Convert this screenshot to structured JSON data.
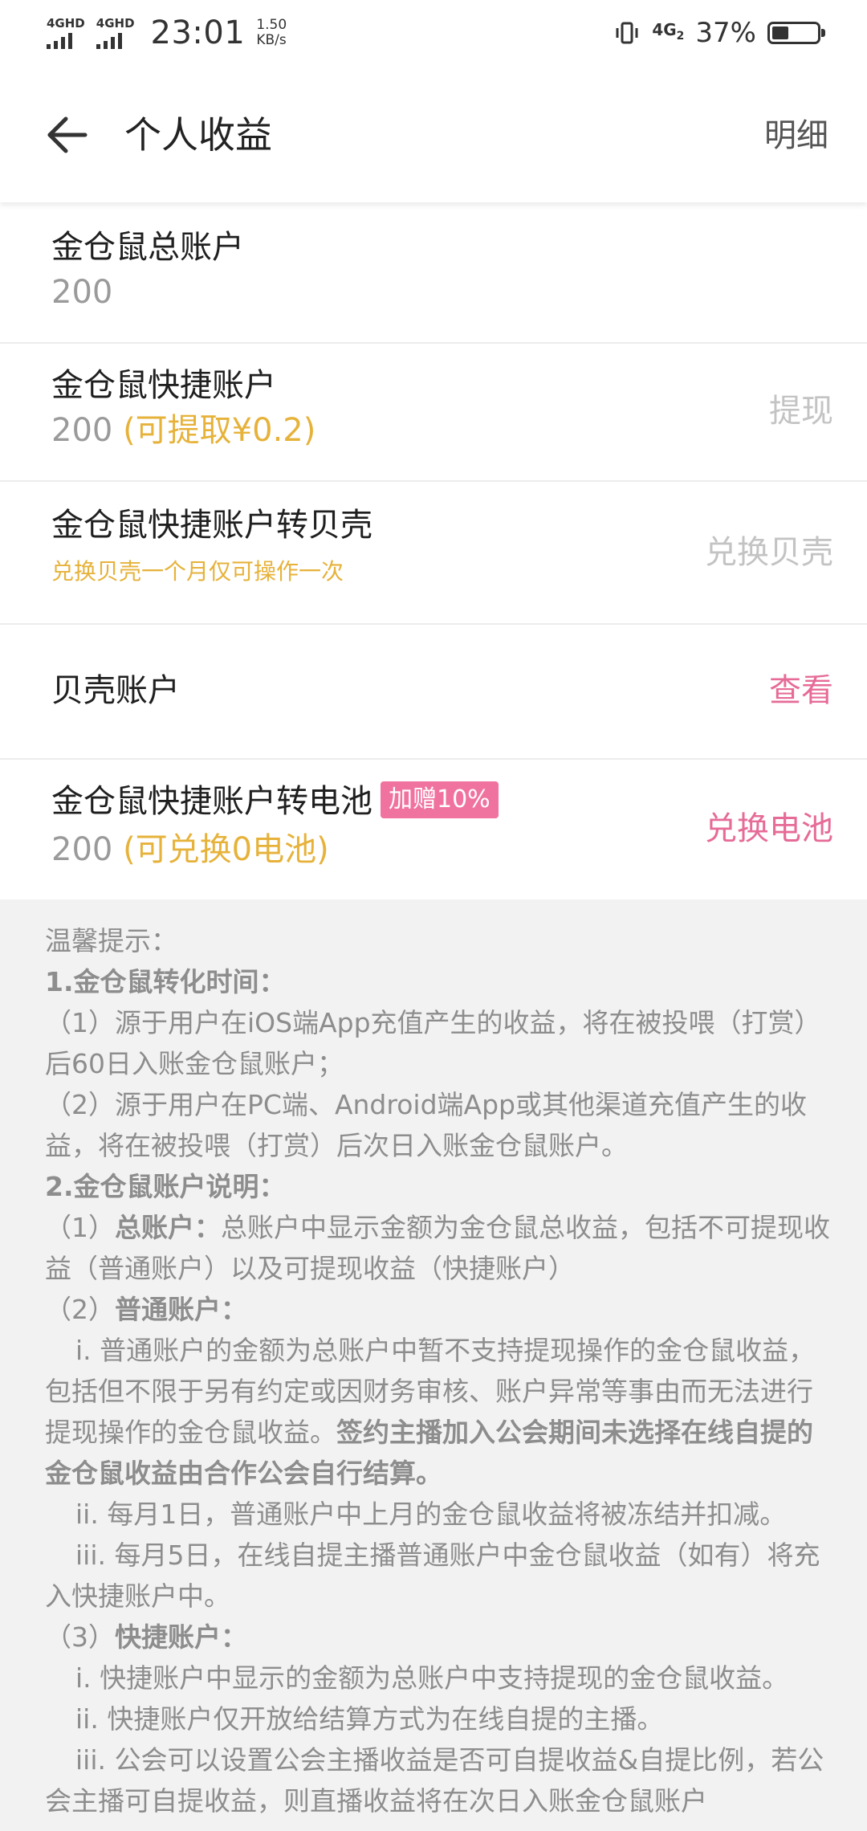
{
  "status_bar": {
    "sim1_label": "4GHD",
    "sim2_label": "4GHD",
    "time": "23:01",
    "speed_value": "1.50",
    "speed_unit": "KB/s",
    "net_label": "4G",
    "net_sub": "2",
    "battery_percent": "37%",
    "battery_level": 0.37
  },
  "header": {
    "title": "个人收益",
    "detail_label": "明细"
  },
  "accounts": {
    "total": {
      "title": "金仓鼠总账户",
      "value": "200"
    },
    "quick": {
      "title": "金仓鼠快捷账户",
      "value": "200",
      "hint": "(可提取¥0.2)",
      "action": "提现"
    },
    "shell_exchange": {
      "title": "金仓鼠快捷账户转贝壳",
      "sub": "兑换贝壳一个月仅可操作一次",
      "action": "兑换贝壳"
    },
    "shell_account": {
      "title": "贝壳账户",
      "action": "查看"
    },
    "battery_exchange": {
      "title": "金仓鼠快捷账户转电池",
      "badge": "加赠10%",
      "value": "200",
      "hint": "(可兑换0电池)",
      "action": "兑换电池"
    }
  },
  "tips": {
    "heading": "温馨提示：",
    "s1_title": "1.金仓鼠转化时间：",
    "s1_p1": "（1）源于用户在iOS端App充值产生的收益，将在被投喂（打赏）后60日入账金仓鼠账户；",
    "s1_p2": "（2）源于用户在PC端、Android端App或其他渠道充值产生的收益，将在被投喂（打赏）后次日入账金仓鼠账户。",
    "s2_title": "2.金仓鼠账户说明：",
    "s2_p1_prefix": "（1）",
    "s2_p1_bold": "总账户：",
    "s2_p1_text": "总账户中显示金额为金仓鼠总收益，包括不可提现收益（普通账户）以及可提现收益（快捷账户）",
    "s2_p2_prefix": "（2）",
    "s2_p2_bold": "普通账户：",
    "s2_p2_i_text": "i. 普通账户的金额为总账户中暂不支持提现操作的金仓鼠收益，包括但不限于另有约定或因财务审核、账户异常等事由而无法进行提现操作的金仓鼠收益。",
    "s2_p2_i_bold": "签约主播加入公会期间未选择在线自提的金仓鼠收益由合作公会自行结算。",
    "s2_p2_ii": "ii. 每月1日，普通账户中上月的金仓鼠收益将被冻结并扣减。",
    "s2_p2_iii": "iii. 每月5日，在线自提主播普通账户中金仓鼠收益（如有）将充入快捷账户中。",
    "s2_p3_prefix": "（3）",
    "s2_p3_bold": "快捷账户：",
    "s2_p3_i": "i. 快捷账户中显示的金额为总账户中支持提现的金仓鼠收益。",
    "s2_p3_ii": "ii. 快捷账户仅开放给结算方式为在线自提的主播。",
    "s2_p3_iii": "iii. 公会可以设置公会主播收益是否可自提收益&自提比例，若公会主播可自提收益，则直播收益将在次日入账金仓鼠账户"
  },
  "colors": {
    "accent_pink": "#e66b97",
    "badge_pink": "#f0739f",
    "hint_yellow": "#e6b23a",
    "muted_gray": "#9a9a9a",
    "tips_bg": "#f2f2f2"
  },
  "icons": {
    "back": "arrow-left-icon",
    "vibrate": "vibrate-icon",
    "battery": "battery-icon"
  }
}
